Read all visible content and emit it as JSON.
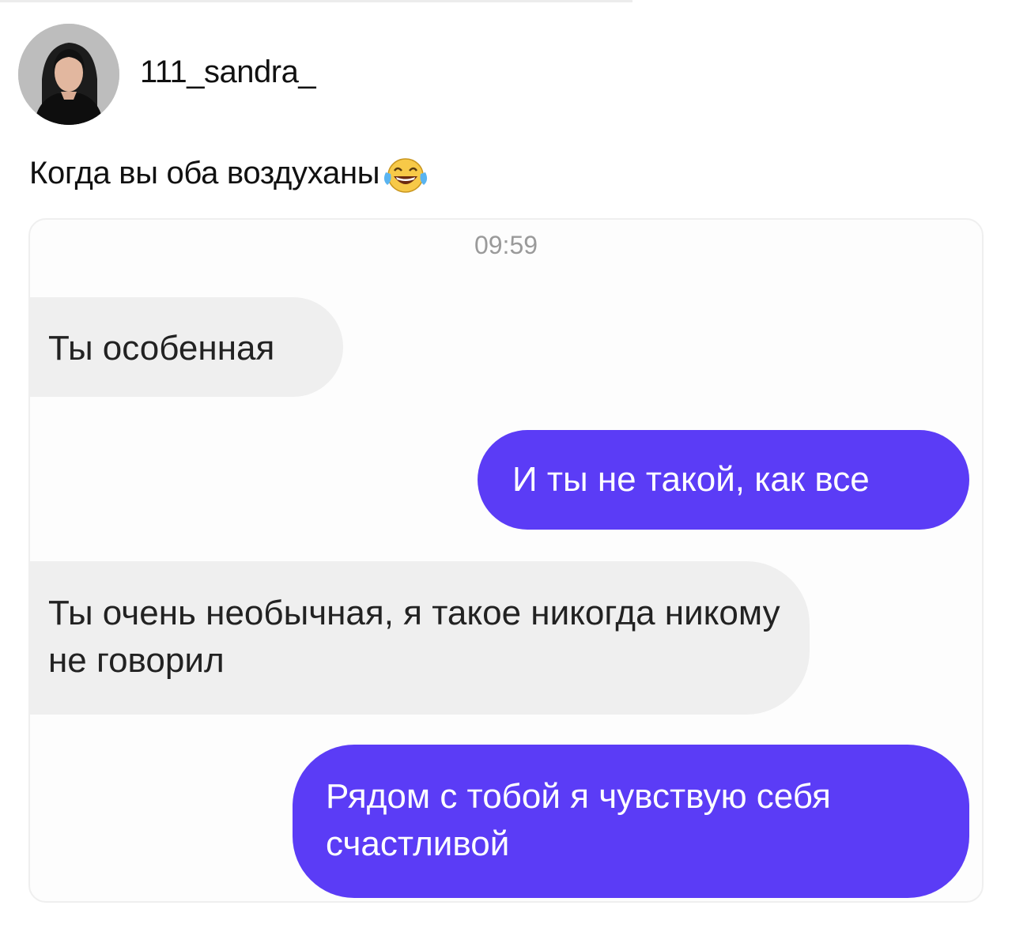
{
  "post": {
    "username": "111_sandra_",
    "caption": "Когда вы оба воздуханы",
    "caption_emoji": "face-with-tears-of-joy-icon"
  },
  "chat": {
    "timestamp": "09:59",
    "messages": [
      {
        "side": "incoming",
        "text": "Ты особенная"
      },
      {
        "side": "outgoing",
        "text": "И ты не такой, как все"
      },
      {
        "side": "incoming",
        "text": "Ты очень необычная, я такое никогда никому не говорил"
      },
      {
        "side": "outgoing",
        "text": "Рядом с тобой я чувствую себя счастливой"
      }
    ]
  },
  "colors": {
    "outgoing_bubble": "#5b3cf6",
    "incoming_bubble": "#efefef",
    "timestamp_text": "#9a9a9a"
  }
}
